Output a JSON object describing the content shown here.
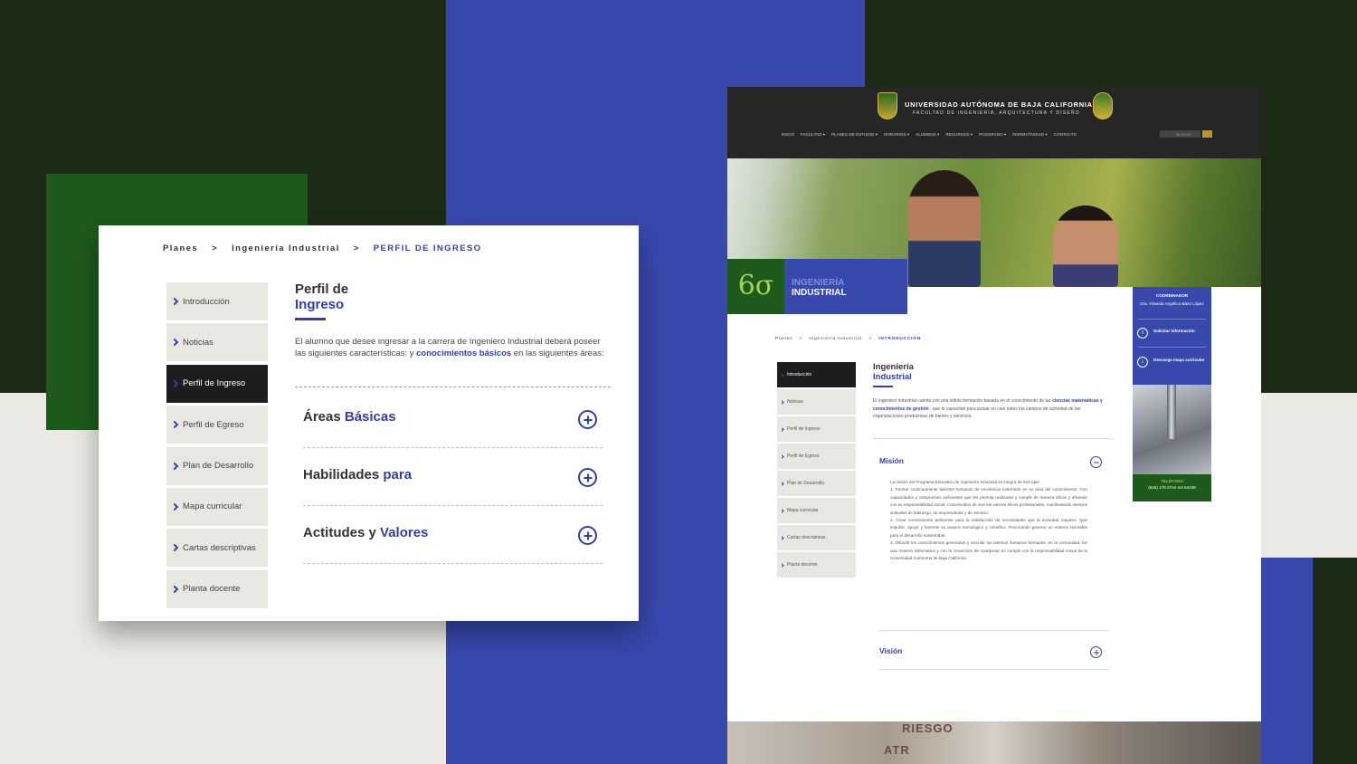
{
  "left": {
    "breadcrumb": [
      "Planes",
      "Ingeniería Industrial",
      "PERFIL DE INGRESO"
    ],
    "breadcrumb_sep": ">",
    "menu": [
      "Introducción",
      "Noticias",
      "Perfil de Ingreso",
      "Perfil de Egreso",
      "Plan de Desarrollo",
      "Mapa curricular",
      "Cartas descriptivas",
      "Planta docente"
    ],
    "active_menu": "Perfil de Ingreso",
    "title_line1": "Perfil de",
    "title_line2": "Ingreso",
    "desc_before": "El alumno que desee ingresar a la carrera de Ingeniero Industrial deberá poseer las siguientes características: y ",
    "desc_bold": "conocimientos básicos",
    "desc_after": " en las siguientes áreas:",
    "accordion": [
      {
        "a": "Áreas ",
        "b": "Básicas"
      },
      {
        "a": "Habilidades ",
        "b": "para"
      },
      {
        "a": "Actitudes y ",
        "b": "Valores"
      }
    ]
  },
  "site": {
    "university": "UNIVERSIDAD AUTÓNOMA DE BAJA CALIFORNIA",
    "faculty": "FACULTAD DE INGENIERÍA, ARQUITECTURA Y DISEÑO",
    "nav": [
      "INICIO",
      "FACULTAD ▾",
      "PLANES DE ESTUDIO ▾",
      "HORARIOS ▾",
      "ALUMNOS ▾",
      "RECURSOS ▾",
      "POSGRADO ▾",
      "NORMATIVIDAD ▾",
      "CONTACTO"
    ],
    "search_placeholder": "BUSCAR",
    "badge_symbol": "6σ",
    "hero_line1": "INGENIERÍA",
    "hero_line2": "INDUSTRIAL",
    "coordinator_label": "COORDINADOR",
    "coordinator_name": "Dra. Yolanda Angélica Báez López",
    "side_link1": "Solicitar información",
    "side_link2": "Descarga mapa curricular",
    "phone_label": "TELÉFONO",
    "phone": "(646) 175 0744 ext 64348",
    "breadcrumb": [
      "Planes",
      "Ingeniería Industrial",
      "INTRODUCCIÓN"
    ],
    "menu": [
      "Introducción",
      "Noticias",
      "Perfil de Ingreso",
      "Perfil de Egreso",
      "Plan de Desarrollo",
      "Mapa curricular",
      "Cartas descriptivas",
      "Planta docente"
    ],
    "title_line1": "Ingeniería",
    "title_line2": "Industrial",
    "desc_before": "El ingeniero industrial cuenta con una sólida formación basada en el conocimiento de las ",
    "desc_bold": "ciencias matemáticas y conocimientos de gestión",
    "desc_after": " , que lo capacitan para actuar en casi todos los campos de actividad de las organizaciones productivas de bienes y servicios.",
    "mision_label": "Misión",
    "mision_intro": "La misión del Programa Educativo de Ingeniería Industrial se integra de tres ejes:",
    "mision_items": [
      "1. Formar continuamente talentos humanos de excelencia sobretodo en su área del conocimiento. Con capacidades y compromiso suficientes que les permita realizarse y cumplir de manera eficaz y eficiente con su responsabilidad social. Convencidos de vivir los valores éticos profesionales, manifestando siempre actitudes de liderazgo, de emprendedor y de servicio.",
      "2. Crear conocimiento pertinente para la satisfacción de necesidades que la sociedad requiere. Que impulse, apoye y fomente su avance tecnológico y científico. Procurando generar un entorno favorable para el desarrollo sustentable.",
      "3. Difundir los conocimientos generados y vincular los talentos humanos formados, en la comunidad. De una manera sistemática y con la convicción de coadyuvar en cumplir con la responsabilidad social de la Universidad Autónoma de Baja California"
    ],
    "vision_label": "Visión",
    "bottom_sign1": "RIESGO",
    "bottom_sign2": "ATR"
  },
  "colors": {
    "brand_blue": "#3848ad",
    "brand_green": "#1d5a1b",
    "dark": "#1b2b16"
  }
}
